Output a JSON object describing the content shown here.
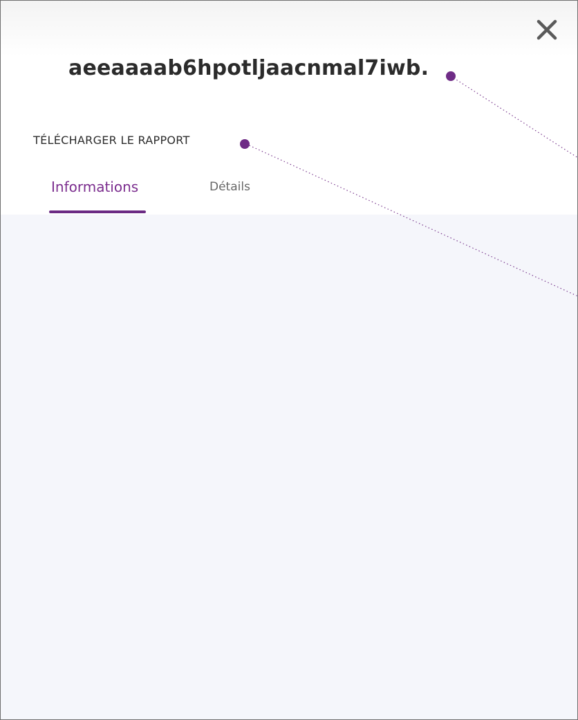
{
  "dialog": {
    "title": "aeeaaaab6hpotljaacnmal7iwb.",
    "download_report_label": "TÉLÉCHARGER LE RAPPORT",
    "close_icon": "close-icon"
  },
  "tabs": [
    {
      "label": "Informations",
      "active": true
    },
    {
      "label": "Détails",
      "active": false
    }
  ],
  "colors": {
    "accent": "#7b2d8e",
    "underline": "#6b2a83",
    "content_bg": "#f5f6fb",
    "text_dark": "#2b2b2b",
    "annotation_dot": "#6f2c86"
  }
}
